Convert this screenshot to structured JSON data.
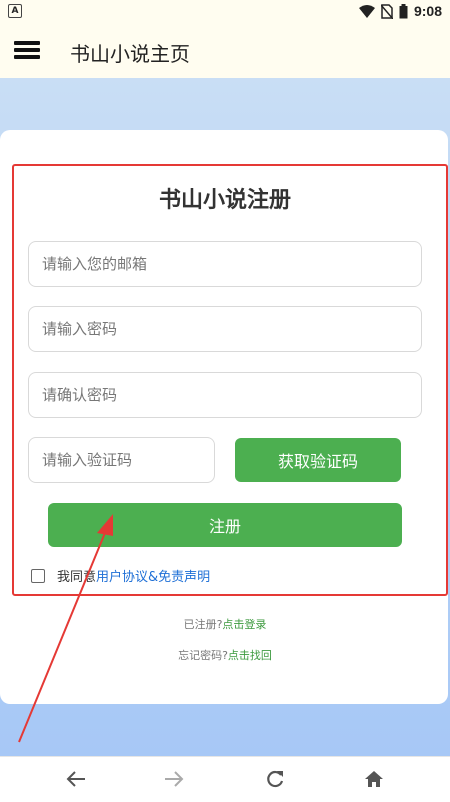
{
  "status_bar": {
    "time": "9:08"
  },
  "app_bar": {
    "title": "书山小说主页"
  },
  "form": {
    "title": "书山小说注册",
    "email_placeholder": "请输入您的邮箱",
    "password_placeholder": "请输入密码",
    "confirm_placeholder": "请确认密码",
    "code_placeholder": "请输入验证码",
    "get_code_label": "获取验证码",
    "register_label": "注册",
    "agree_prefix": "我同意",
    "agree_link": "用户协议&免责声明"
  },
  "login": {
    "prefix": "已注册?",
    "link": "点击登录"
  },
  "recover": {
    "prefix": "忘记密码?",
    "link": "点击找回"
  },
  "colors": {
    "accent_green": "#4caf50",
    "link_blue": "#1e6fd6",
    "highlight_red": "#e53935"
  },
  "icons": [
    "menu-icon",
    "wifi-icon",
    "no-sim-icon",
    "battery-icon",
    "back-icon",
    "forward-icon",
    "reload-icon",
    "home-icon"
  ]
}
